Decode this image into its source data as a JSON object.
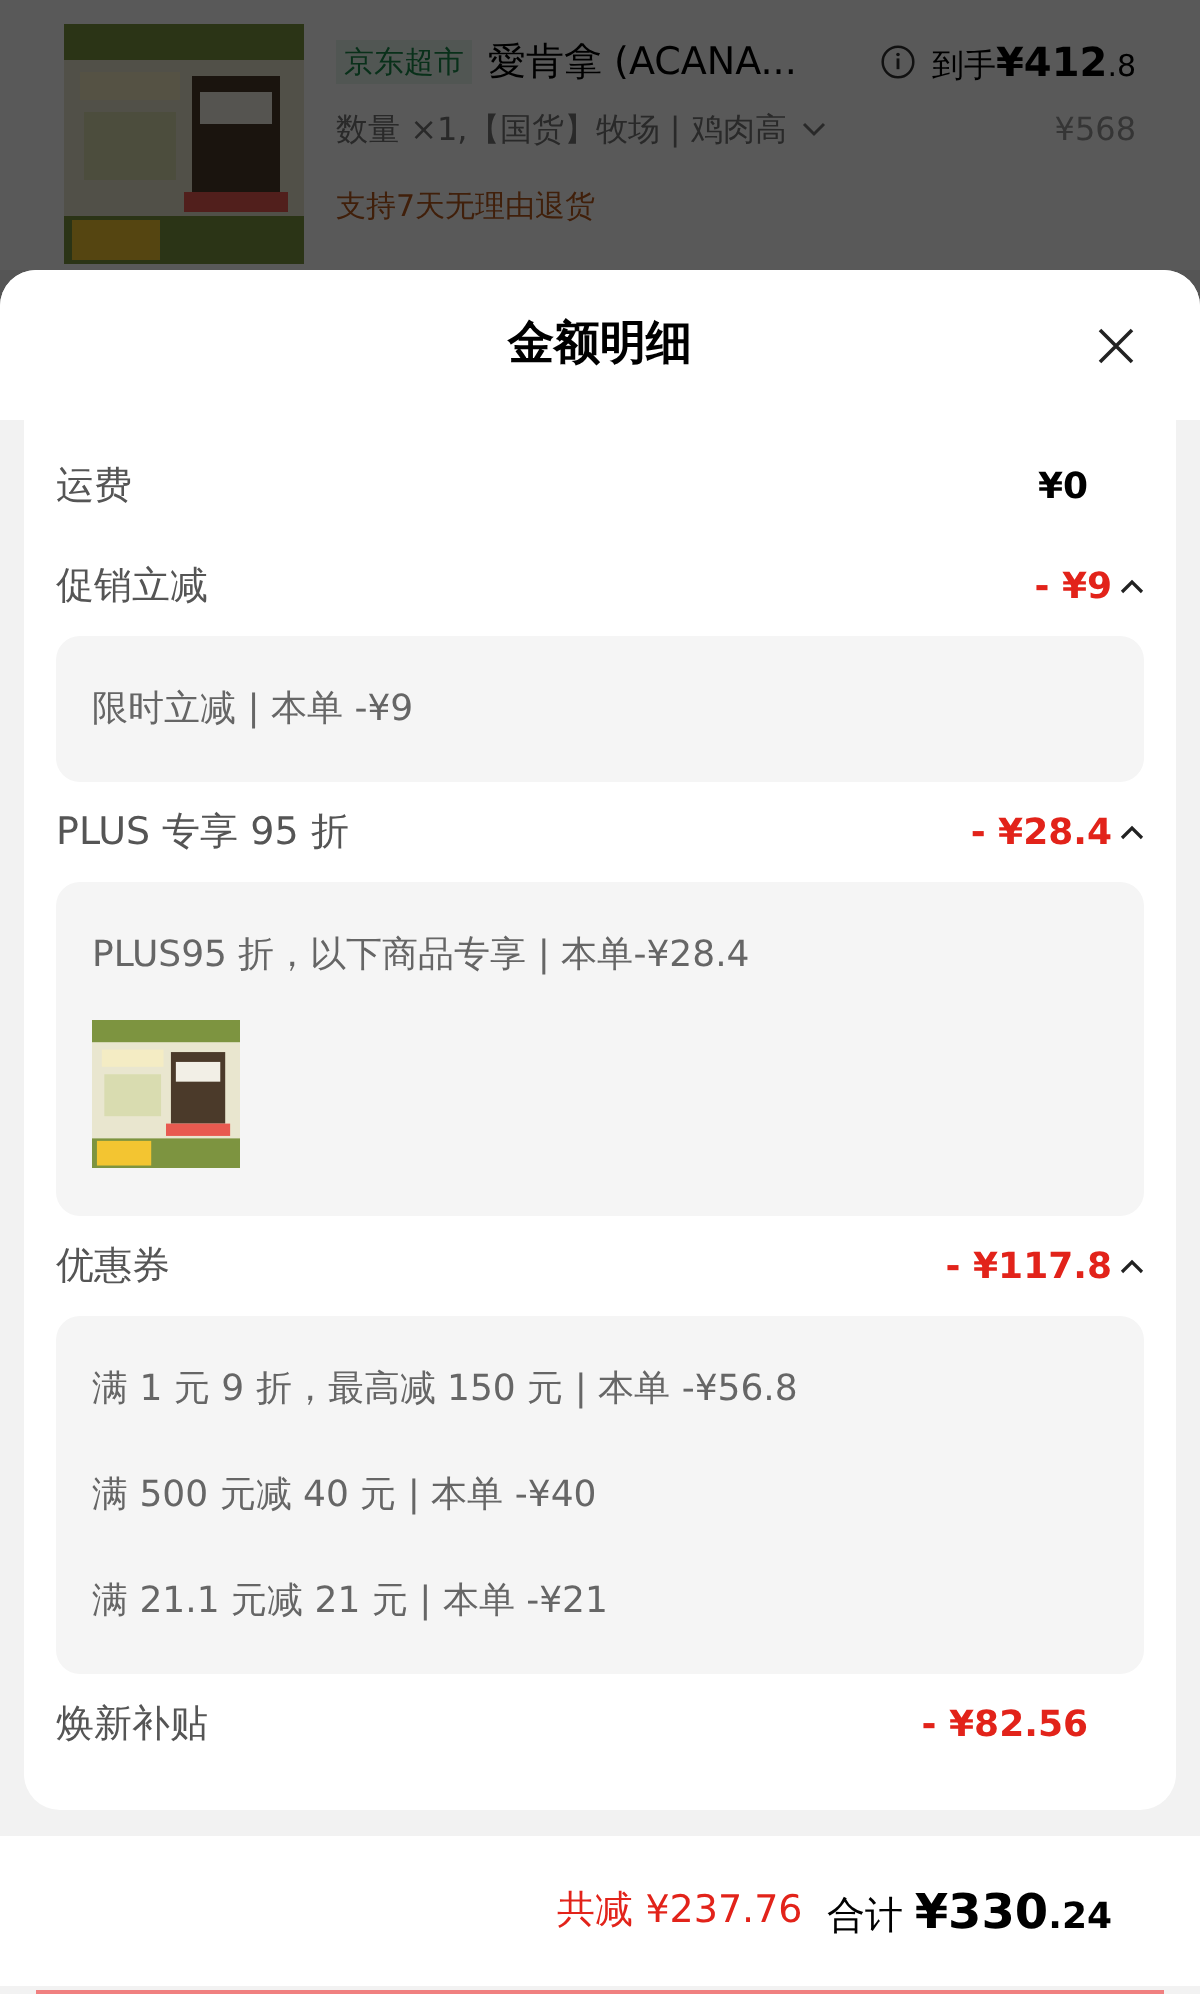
{
  "product": {
    "store_tag": "京东超市",
    "title": "愛肯拿 (ACANA...",
    "price_label": "到手",
    "price_main": "¥412",
    "price_decimal": ".8",
    "spec": "数量 ×1,【国货】牧场 | 鸡肉高",
    "original_price": "¥568",
    "return_policy": "支持7天无理由退货"
  },
  "sheet": {
    "title": "金额明细",
    "rows": [
      {
        "label": "运费",
        "amount": "¥0",
        "discount": false
      },
      {
        "label": "促销立减",
        "amount": "- ¥9",
        "discount": true,
        "expanded": true,
        "details": [
          {
            "text": "限时立减 | 本单 -¥9"
          }
        ]
      },
      {
        "label": "PLUS 专享 95 折",
        "amount": "- ¥28.4",
        "discount": true,
        "expanded": true,
        "details": [
          {
            "text": "PLUS95 折，以下商品专享 | 本单-¥28.4",
            "kind": "picture"
          }
        ]
      },
      {
        "label": "优惠券",
        "amount": "- ¥117.8",
        "discount": true,
        "expanded": true,
        "details": [
          {
            "text": "满 1 元 9 折，最高减 150 元 | 本单 -¥56.8"
          },
          {
            "text": "满 500 元减 40 元 | 本单 -¥40"
          },
          {
            "text": "满 21.1 元减 21 元 | 本单 -¥21"
          }
        ]
      },
      {
        "label": "焕新补贴",
        "amount": "- ¥82.56",
        "discount": true
      }
    ]
  },
  "footer": {
    "saved": "共减 ¥237.76",
    "total_label": "合计",
    "total_main": "¥330",
    "total_decimal": ".24"
  }
}
